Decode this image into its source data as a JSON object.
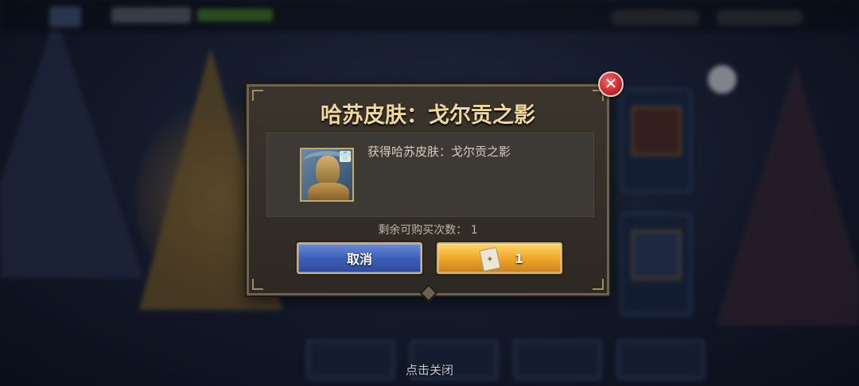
{
  "dialog": {
    "title": "哈苏皮肤：戈尔贡之影",
    "item": {
      "name": "哈苏皮肤：戈尔贡之影",
      "description": "获得哈苏皮肤：戈尔贡之影",
      "icon": "gorgon-skin-portrait-icon",
      "badge_icon": "shirt-icon"
    },
    "remaining_label": "剩余可购买次数：",
    "remaining_value": "1",
    "cancel_label": "取消",
    "buy": {
      "currency_icon": "ticket-icon",
      "cost": "1"
    },
    "close_icon": "close-icon"
  },
  "footer": {
    "tap_close_label": "点击关闭"
  },
  "colors": {
    "title": "#f0d79a",
    "cancel_button": "#3d5fb8",
    "buy_button": "#f0a92a",
    "close_button": "#c8262b"
  }
}
